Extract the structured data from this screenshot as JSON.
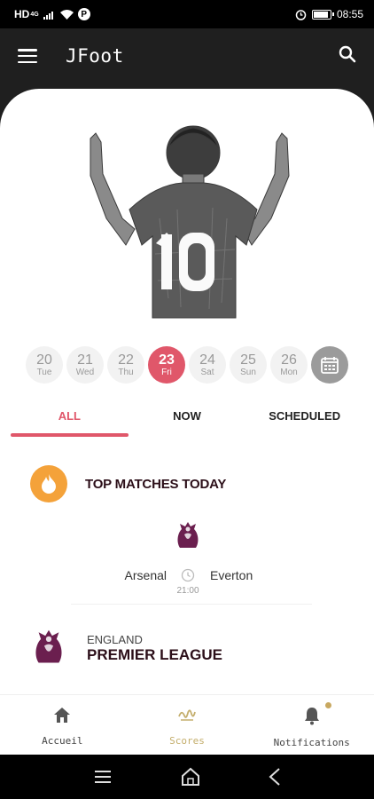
{
  "status_bar": {
    "network": "HD",
    "network_sup": "4G",
    "p_label": "P",
    "time": "08:55",
    "battery_level": 0.8
  },
  "app_bar": {
    "menu_icon": "hamburger-menu-icon",
    "title": "JFoot",
    "search_icon": "search-icon"
  },
  "dates": [
    {
      "day": "20",
      "dow": "Tue",
      "active": false
    },
    {
      "day": "21",
      "dow": "Wed",
      "active": false
    },
    {
      "day": "22",
      "dow": "Thu",
      "active": false
    },
    {
      "day": "23",
      "dow": "Fri",
      "active": true
    },
    {
      "day": "24",
      "dow": "Sat",
      "active": false
    },
    {
      "day": "25",
      "dow": "Sun",
      "active": false
    },
    {
      "day": "26",
      "dow": "Mon",
      "active": false
    }
  ],
  "calendar_icon": "calendar-icon",
  "tabs": [
    {
      "label": "ALL",
      "active": true
    },
    {
      "label": "NOW",
      "active": false
    },
    {
      "label": "SCHEDULED",
      "active": false
    }
  ],
  "top_matches": {
    "title": "TOP MATCHES TODAY",
    "icon": "fire-icon"
  },
  "match": {
    "home": "Arsenal",
    "away": "Everton",
    "time": "21:00",
    "league_icon": "premier-league-lion-icon"
  },
  "league": {
    "country": "ENGLAND",
    "name": "PREMIER LEAGUE"
  },
  "bottom_nav": [
    {
      "label": "Accueil",
      "icon": "home-icon",
      "active": false
    },
    {
      "label": "Scores",
      "icon": "scores-icon",
      "active": true
    },
    {
      "label": "Notifications",
      "icon": "bell-icon",
      "active": false
    }
  ],
  "colors": {
    "accent": "#e0576a",
    "fire": "#f4a23a",
    "league_purple": "#6b1f4f",
    "active_nav": "#c4ae6c"
  }
}
